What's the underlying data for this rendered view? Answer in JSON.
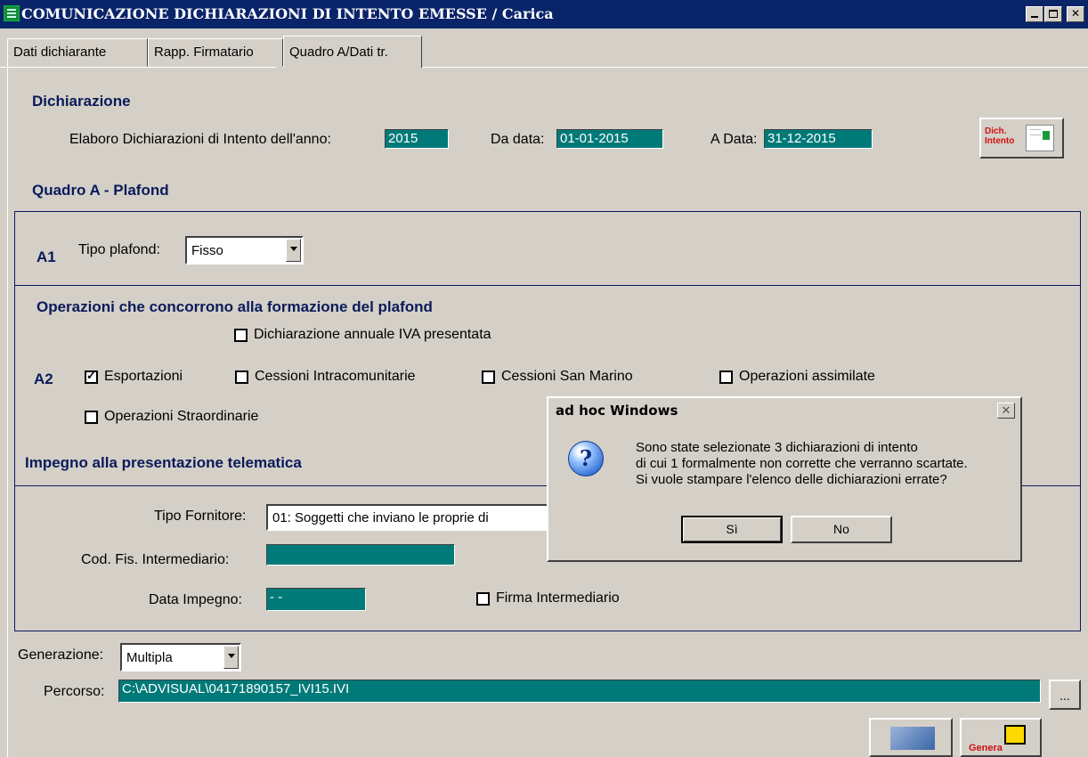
{
  "window": {
    "title": "COMUNICAZIONE DICHIARAZIONI DI INTENTO EMESSE / Carica",
    "buttons": [
      "minimize",
      "maximize",
      "close"
    ]
  },
  "tabs": [
    {
      "label": "Dati dichiarante",
      "active": false
    },
    {
      "label": "Rapp. Firmatario",
      "active": false
    },
    {
      "label": "Quadro A/Dati tr.",
      "active": true
    }
  ],
  "dichiarazione": {
    "section_title": "Dichiarazione",
    "anno_label": "Elaboro Dichiarazioni di Intento dell'anno:",
    "anno_value": "2015",
    "da_data_label": "Da data:",
    "da_data_value": "01-01-2015",
    "a_data_label": "A Data:",
    "a_data_value": "31-12-2015",
    "dich_button_label": "Dich. Intento"
  },
  "quadro_a": {
    "section_title": "Quadro A - Plafond",
    "a1_code": "A1",
    "tipo_plafond_label": "Tipo plafond:",
    "tipo_plafond_value": "Fisso",
    "operazioni_title": "Operazioni che concorrono alla formazione del plafond",
    "dichiarazione_annuale_label": "Dichiarazione annuale IVA presentata",
    "dichiarazione_annuale_checked": false,
    "a2_code": "A2",
    "checkboxes": [
      {
        "label": "Esportazioni",
        "checked": true
      },
      {
        "label": "Cessioni Intracomunitarie",
        "checked": false
      },
      {
        "label": "Cessioni San Marino",
        "checked": false
      },
      {
        "label": "Operazioni assimilate",
        "checked": false
      },
      {
        "label": "Operazioni Straordinarie",
        "checked": false
      }
    ]
  },
  "impegno": {
    "section_title": "Impegno alla presentazione telematica",
    "tipo_fornitore_label": "Tipo Fornitore:",
    "tipo_fornitore_value": "01: Soggetti che inviano le proprie di",
    "cod_fis_label": "Cod. Fis. Intermediario:",
    "cod_fis_value": "",
    "data_impegno_label": "Data Impegno:",
    "data_impegno_value": "- -",
    "firma_label": "Firma Intermediario",
    "firma_checked": false
  },
  "generazione": {
    "label": "Generazione:",
    "value": "Multipla",
    "percorso_label": "Percorso:",
    "percorso_value": "C:\\ADVISUAL\\04171890157_IVI15.IVI",
    "browse_label": "...",
    "genera_label": "Genera"
  },
  "dialog": {
    "title": "ad hoc Windows",
    "icon": "question-icon",
    "message_lines": [
      "Sono state selezionate 3 dichiarazioni di intento",
      "di cui 1 formalmente non corrette che verranno scartate.",
      "Si vuole stampare l'elenco delle dichiarazioni errate?"
    ],
    "yes_label": "Sì",
    "no_label": "No"
  },
  "colors": {
    "title_bar": "#0a246a",
    "field_teal": "#007a78",
    "section_navy": "#0a1a5a",
    "window_bg": "#d4d0c8"
  }
}
